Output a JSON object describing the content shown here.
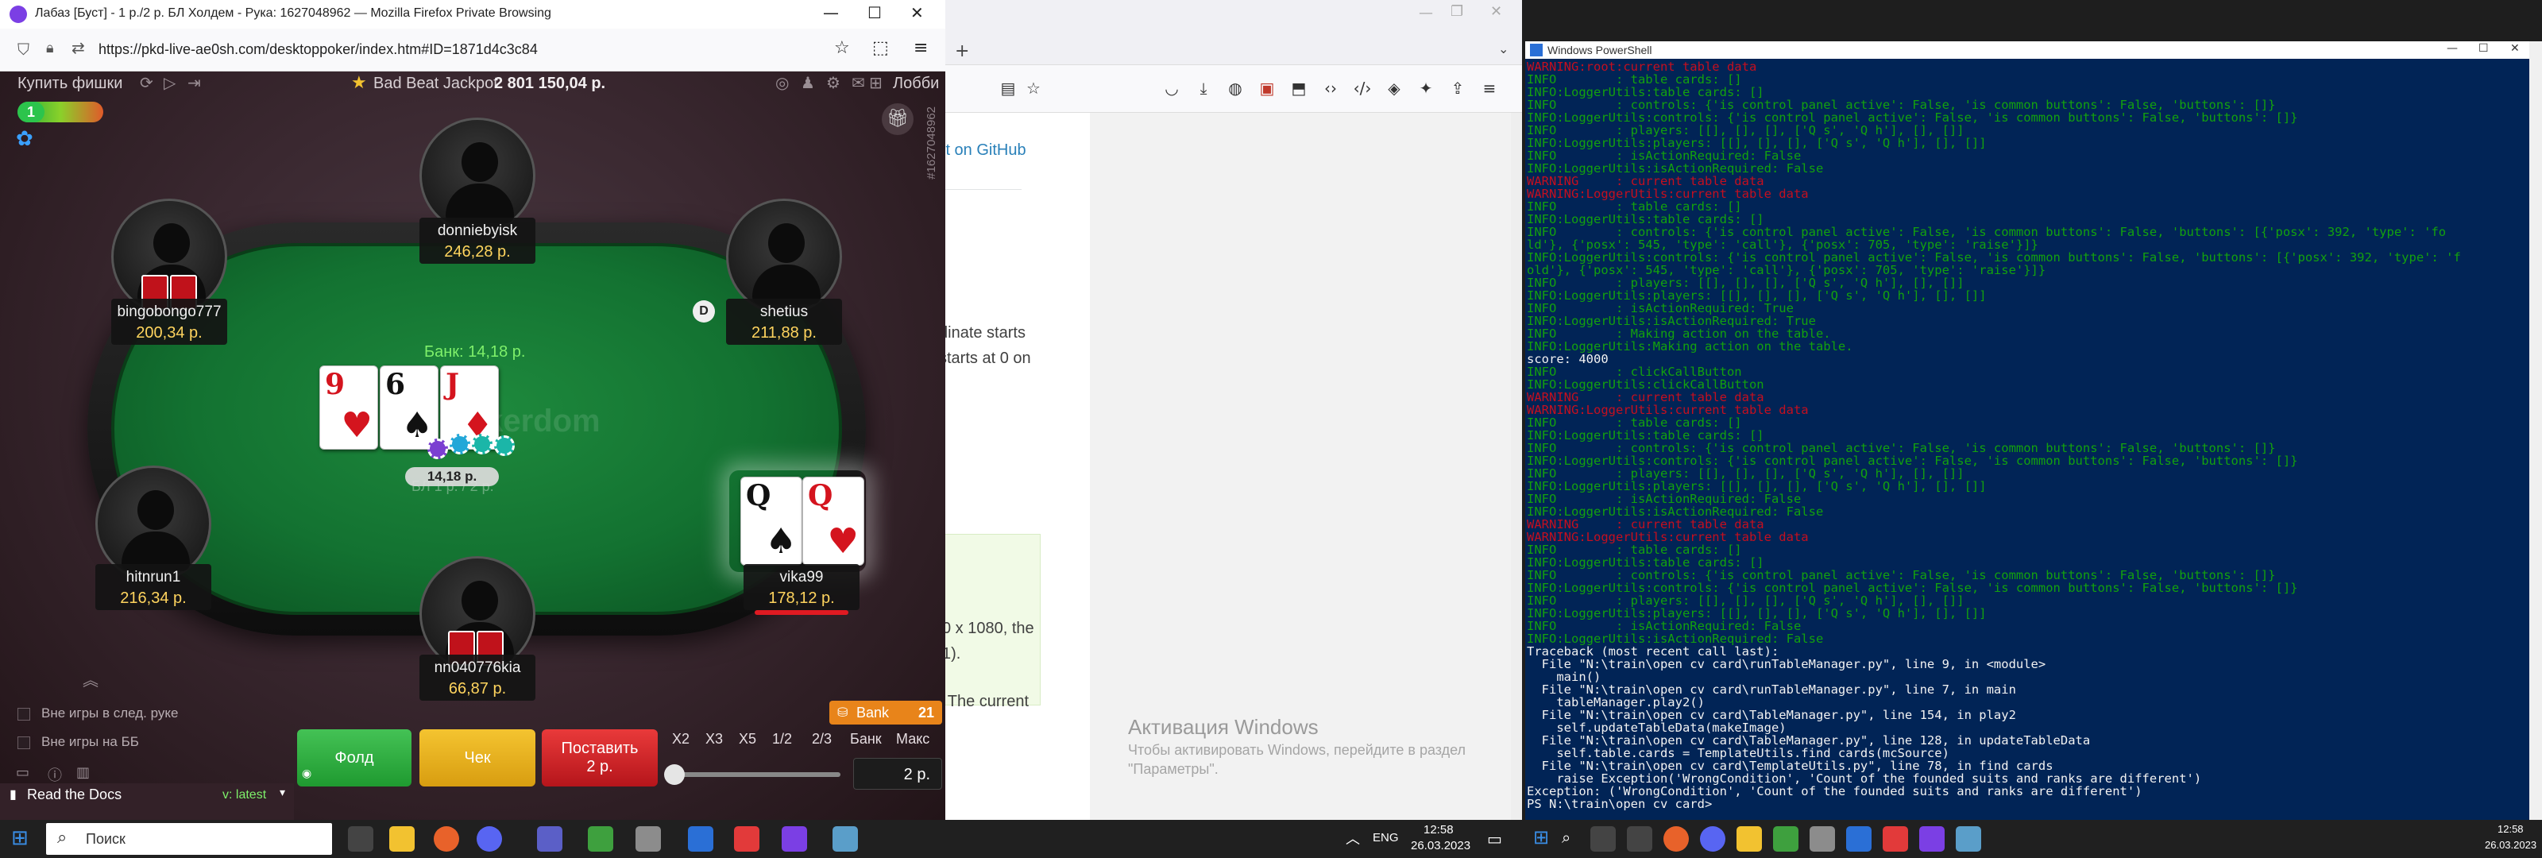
{
  "poker_window": {
    "title": "Лабаз [Буст] - 1 р./2 р. БЛ Холдем - Рука: 1627048962 — Mozilla Firefox Private Browsing",
    "url": "https://pkd-live-ae0sh.com/desktoppoker/index.htm#ID=1871d4c3c84",
    "buy_chips": "Купить фишки",
    "jackpot_label": "Bad Beat Jackpot",
    "jackpot_value": "2 801 150,04 р.",
    "lobby": "Лобби",
    "hand_id_vertical": "#1627048962",
    "level": "1",
    "pot_label": "Банк: 14,18 р.",
    "pot_chips": "14,18 р.",
    "blinds_text": "БЛ 1 р. / 2 р.",
    "felt_logo": "Pokerdom",
    "dealer": "D",
    "board": [
      {
        "rank": "9",
        "suit": "♥",
        "color": "red"
      },
      {
        "rank": "6",
        "suit": "♠",
        "color": "black"
      },
      {
        "rank": "J",
        "suit": "♦",
        "color": "red"
      }
    ],
    "hero_cards": [
      {
        "rank": "Q",
        "suit": "♠",
        "color": "black"
      },
      {
        "rank": "Q",
        "suit": "♥",
        "color": "red"
      }
    ],
    "seats": {
      "top": {
        "name": "donniebyisk",
        "stack": "246,28 р."
      },
      "left_upper": {
        "name": "bingobongo777",
        "stack": "200,34 р."
      },
      "right_upper": {
        "name": "shetius",
        "stack": "211,88 р."
      },
      "left_lower": {
        "name": "hitnrun1",
        "stack": "216,34 р."
      },
      "bottom": {
        "name": "nn040776kia",
        "stack": "66,87 р."
      },
      "hero": {
        "name": "vika99",
        "stack": "178,12 р."
      }
    },
    "options": {
      "sitout_next": "Вне игры в след. руке",
      "sitout_bb": "Вне игры на ББ"
    },
    "actions": {
      "fold": "Фолд",
      "check": "Чек",
      "bet": "Поставить",
      "bet_amount": "2 р."
    },
    "presets": [
      "X2",
      "X3",
      "X5",
      "1/2",
      "2/3",
      "Банк",
      "Макс"
    ],
    "bank_pill_label": "Bank",
    "bank_pill_value": "21",
    "bet_input": "2 р.",
    "read_docs": "Read the Docs",
    "version": "v: latest"
  },
  "bg_browser": {
    "edit_github": "it on GitHub",
    "lines": [
      "dinate starts",
      " starts at 0 on",
      "0 x 1080, the",
      "1).",
      ". The current"
    ],
    "activation_title": "Активация Windows",
    "activation_sub1": "Чтобы активировать Windows, перейдите в раздел",
    "activation_sub2": "\"Параметры\"."
  },
  "powershell": {
    "title": "Windows PowerShell",
    "lines": [
      {
        "c": "r",
        "t": "WARNING:root:current table data"
      },
      {
        "c": "g",
        "t": "INFO        : table cards: []"
      },
      {
        "c": "g",
        "t": "INFO:LoggerUtils:table cards: []"
      },
      {
        "c": "g",
        "t": "INFO        : controls: {'is_control_panel_active': False, 'is_common_buttons': False, 'buttons': []}"
      },
      {
        "c": "g",
        "t": "INFO:LoggerUtils:controls: {'is_control_panel_active': False, 'is_common_buttons': False, 'buttons': []}"
      },
      {
        "c": "g",
        "t": "INFO        : players: [[], [], [], ['Q_s', 'Q_h'], [], []]"
      },
      {
        "c": "g",
        "t": "INFO:LoggerUtils:players: [[], [], [], ['Q_s', 'Q_h'], [], []]"
      },
      {
        "c": "g",
        "t": "INFO        : isActionRequired: False"
      },
      {
        "c": "g",
        "t": "INFO:LoggerUtils:isActionRequired: False"
      },
      {
        "c": "r",
        "t": "WARNING     : current table data"
      },
      {
        "c": "r",
        "t": "WARNING:LoggerUtils:current table data"
      },
      {
        "c": "g",
        "t": "INFO        : table cards: []"
      },
      {
        "c": "g",
        "t": "INFO:LoggerUtils:table cards: []"
      },
      {
        "c": "g",
        "t": "INFO        : controls: {'is_control_panel_active': False, 'is_common_buttons': False, 'buttons': [{'posx': 392, 'type': 'fo"
      },
      {
        "c": "g",
        "t": "ld'}, {'posx': 545, 'type': 'call'}, {'posx': 705, 'type': 'raise'}]}"
      },
      {
        "c": "g",
        "t": "INFO:LoggerUtils:controls: {'is_control_panel_active': False, 'is_common_buttons': False, 'buttons': [{'posx': 392, 'type': 'f"
      },
      {
        "c": "g",
        "t": "old'}, {'posx': 545, 'type': 'call'}, {'posx': 705, 'type': 'raise'}]}"
      },
      {
        "c": "g",
        "t": "INFO        : players: [[], [], [], ['Q_s', 'Q_h'], [], []]"
      },
      {
        "c": "g",
        "t": "INFO:LoggerUtils:players: [[], [], [], ['Q_s', 'Q_h'], [], []]"
      },
      {
        "c": "g",
        "t": "INFO        : isActionRequired: True"
      },
      {
        "c": "g",
        "t": "INFO:LoggerUtils:isActionRequired: True"
      },
      {
        "c": "g",
        "t": "INFO        : Making action on the table."
      },
      {
        "c": "g",
        "t": "INFO:LoggerUtils:Making action on the table."
      },
      {
        "c": "w",
        "t": "score: 4000"
      },
      {
        "c": "g",
        "t": "INFO        : clickCallButton"
      },
      {
        "c": "g",
        "t": "INFO:LoggerUtils:clickCallButton"
      },
      {
        "c": "r",
        "t": "WARNING     : current table data"
      },
      {
        "c": "r",
        "t": "WARNING:LoggerUtils:current table data"
      },
      {
        "c": "g",
        "t": "INFO        : table cards: []"
      },
      {
        "c": "g",
        "t": "INFO:LoggerUtils:table cards: []"
      },
      {
        "c": "g",
        "t": "INFO        : controls: {'is_control_panel_active': False, 'is_common_buttons': False, 'buttons': []}"
      },
      {
        "c": "g",
        "t": "INFO:LoggerUtils:controls: {'is_control_panel_active': False, 'is_common_buttons': False, 'buttons': []}"
      },
      {
        "c": "g",
        "t": "INFO        : players: [[], [], [], ['Q_s', 'Q_h'], [], []]"
      },
      {
        "c": "g",
        "t": "INFO:LoggerUtils:players: [[], [], [], ['Q_s', 'Q_h'], [], []]"
      },
      {
        "c": "g",
        "t": "INFO        : isActionRequired: False"
      },
      {
        "c": "g",
        "t": "INFO:LoggerUtils:isActionRequired: False"
      },
      {
        "c": "r",
        "t": "WARNING     : current table data"
      },
      {
        "c": "r",
        "t": "WARNING:LoggerUtils:current table data"
      },
      {
        "c": "g",
        "t": "INFO        : table cards: []"
      },
      {
        "c": "g",
        "t": "INFO:LoggerUtils:table cards: []"
      },
      {
        "c": "g",
        "t": "INFO        : controls: {'is_control_panel_active': False, 'is_common_buttons': False, 'buttons': []}"
      },
      {
        "c": "g",
        "t": "INFO:LoggerUtils:controls: {'is_control_panel_active': False, 'is_common_buttons': False, 'buttons': []}"
      },
      {
        "c": "g",
        "t": "INFO        : players: [[], [], [], ['Q_s', 'Q_h'], [], []]"
      },
      {
        "c": "g",
        "t": "INFO:LoggerUtils:players: [[], [], [], ['Q_s', 'Q_h'], [], []]"
      },
      {
        "c": "g",
        "t": "INFO        : isActionRequired: False"
      },
      {
        "c": "g",
        "t": "INFO:LoggerUtils:isActionRequired: False"
      },
      {
        "c": "w",
        "t": "Traceback (most recent call last):"
      },
      {
        "c": "w",
        "t": "  File \"N:\\train\\open_cv_card\\runTableManager.py\", line 9, in <module>"
      },
      {
        "c": "w",
        "t": "    main()"
      },
      {
        "c": "w",
        "t": "  File \"N:\\train\\open_cv_card\\runTableManager.py\", line 7, in main"
      },
      {
        "c": "w",
        "t": "    tableManager.play2()"
      },
      {
        "c": "w",
        "t": "  File \"N:\\train\\open_cv_card\\TableManager.py\", line 154, in play2"
      },
      {
        "c": "w",
        "t": "    self.updateTableData(makeImage)"
      },
      {
        "c": "w",
        "t": "  File \"N:\\train\\open_cv_card\\TableManager.py\", line 128, in updateTableData"
      },
      {
        "c": "w",
        "t": "    self.table.cards = TemplateUtils.find_cards(mcSource)"
      },
      {
        "c": "w",
        "t": "  File \"N:\\train\\open_cv_card\\TemplateUtils.py\", line 78, in find_cards"
      },
      {
        "c": "w",
        "t": "    raise Exception('WrongCondition', 'Count of the founded suits and ranks are different')"
      },
      {
        "c": "w",
        "t": "Exception: ('WrongCondition', 'Count of the founded suits and ranks are different')"
      },
      {
        "c": "w",
        "t": "PS N:\\train\\open_cv_card> _"
      }
    ]
  },
  "taskbar_left": {
    "search": "Поиск",
    "lang": "ENG",
    "time": "12:58",
    "date": "26.03.2023"
  },
  "taskbar_right": {
    "time": "12:58",
    "date": "26.03.2023"
  },
  "colors": {
    "felt": "#137231",
    "ps_bg": "#012456",
    "fold": "#1f9a30",
    "check": "#d89d10",
    "bet": "#b5151b"
  }
}
